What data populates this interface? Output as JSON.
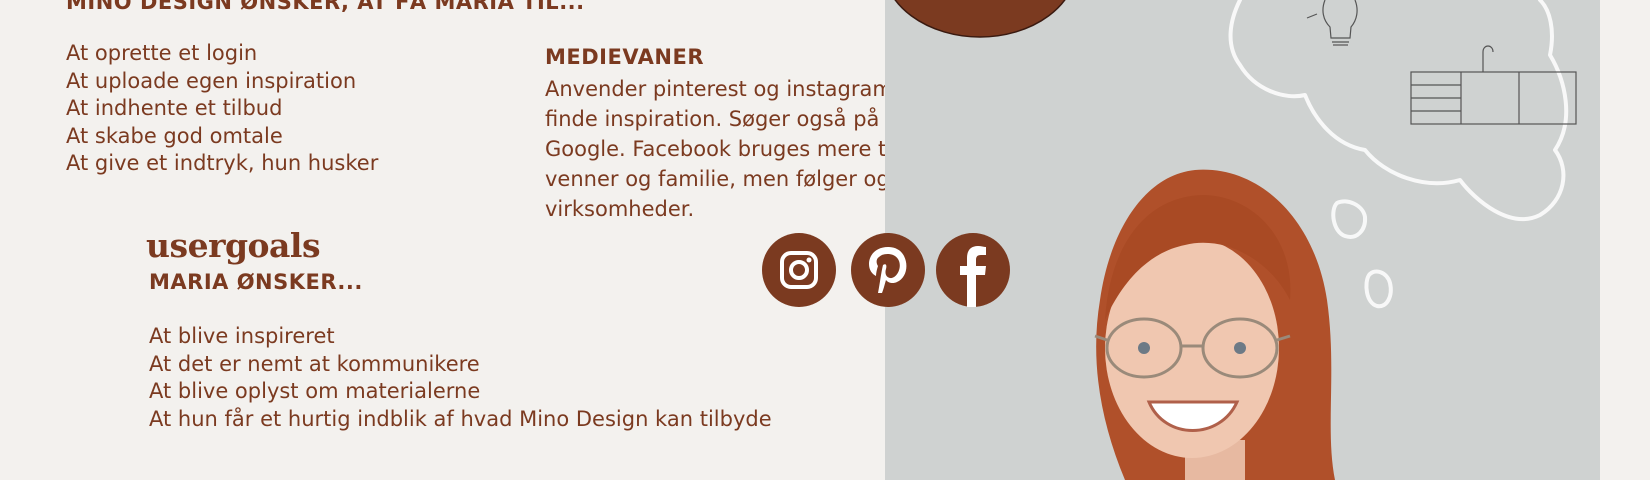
{
  "business_goals": {
    "heading": "MINO DESIGN ØNSKER, AT FÅ MARIA TIL...",
    "items": [
      "At  oprette et login",
      "At uploade egen inspiration",
      "At indhente et tilbud",
      "At skabe god omtale",
      "At give et indtryk, hun husker"
    ]
  },
  "media_habits": {
    "title": "MEDIEVANER",
    "text": "Anvender pinterest og instagram til at finde inspiration. Søger også på Google. Facebook bruges mere til venner og familie, men følger også virksomheder."
  },
  "user_goals": {
    "title": "usergoals",
    "subtitle": "MARIA ØNSKER...",
    "items": [
      "At blive inspireret",
      "At det er nemt at kommunikere",
      "At blive oplyst om materialerne",
      "At hun får et hurtig indblik af hvad Mino Design kan tilbyde"
    ]
  },
  "social_icons": [
    "instagram-icon",
    "pinterest-icon",
    "facebook-icon"
  ],
  "colors": {
    "accent": "#7b3a20",
    "background": "#f3f1ee",
    "photo_background": "#cfd2d1",
    "hair": "#b0502a"
  }
}
